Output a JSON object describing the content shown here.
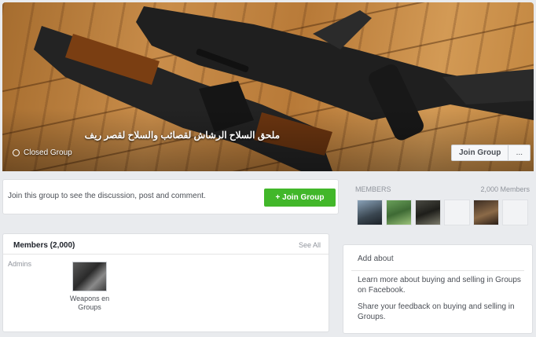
{
  "cover": {
    "group_name": "ملحق السلاح الرشاش لقصائب والسلاح لقصر ريف",
    "group_type": "Closed Group",
    "join_button": "Join Group",
    "more_button": "..."
  },
  "join_prompt": {
    "text": "Join this group to see the discussion, post and comment.",
    "button": "+ Join Group"
  },
  "members_card": {
    "title": "Members (2,000)",
    "see_all": "See All",
    "admins_label": "Admins",
    "admin_name": "Weapons en Groups"
  },
  "sidebar": {
    "members_label": "MEMBERS",
    "members_count": "2,000 Members"
  },
  "about": {
    "title": "Add about",
    "line1": "Learn more about buying and selling in Groups on Facebook.",
    "line2": "Share your feedback on buying and selling in Groups."
  },
  "colors": {
    "join_green": "#42b72a",
    "background": "#e9ebee"
  }
}
